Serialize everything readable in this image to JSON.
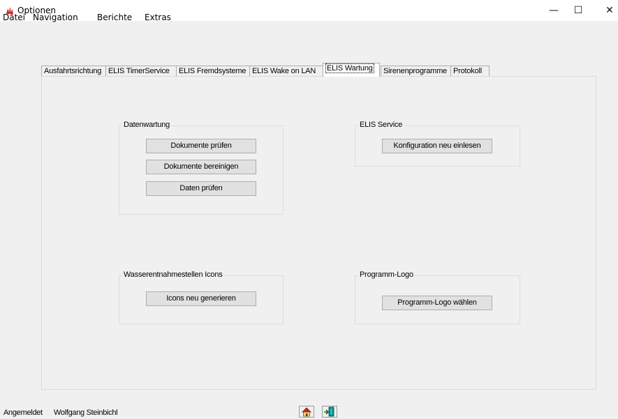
{
  "window": {
    "title": "Optionen",
    "icon": "fire-department-icon",
    "controls": {
      "minimize": "—",
      "maximize": "☐",
      "close": "✕"
    }
  },
  "menu": [
    "Datei",
    "Navigation",
    "Berichte",
    "Extras"
  ],
  "tabs": [
    {
      "label": "Ausfahrtsrichtung"
    },
    {
      "label": "ELIS TimerService"
    },
    {
      "label": "ELIS Fremdsysteme"
    },
    {
      "label": "ELIS Wake on LAN"
    },
    {
      "label": "ELIS Wartung",
      "active": true
    },
    {
      "label": "Sirenenprogramme"
    },
    {
      "label": "Protokoll"
    }
  ],
  "groups": {
    "datenwartung": {
      "title": "Datenwartung",
      "buttons": [
        "Dokumente prüfen",
        "Dokumente bereinigen",
        "Daten prüfen"
      ]
    },
    "elis_service": {
      "title": "ELIS Service",
      "buttons": [
        "Konfiguration neu einlesen"
      ]
    },
    "wasser_icons": {
      "title": "Wasserentnahmestellen Icons",
      "buttons": [
        "Icons neu generieren"
      ]
    },
    "programm_logo": {
      "title": "Programm-Logo",
      "buttons": [
        "Programm-Logo wählen"
      ]
    }
  },
  "status": {
    "label": "Angemeldet",
    "user": "Wolfgang Steinbichl",
    "icons": [
      "home-icon",
      "exit-door-icon"
    ]
  },
  "colors": {
    "icon_red": "#cc2222",
    "icon_teal": "#0a8a8a"
  }
}
